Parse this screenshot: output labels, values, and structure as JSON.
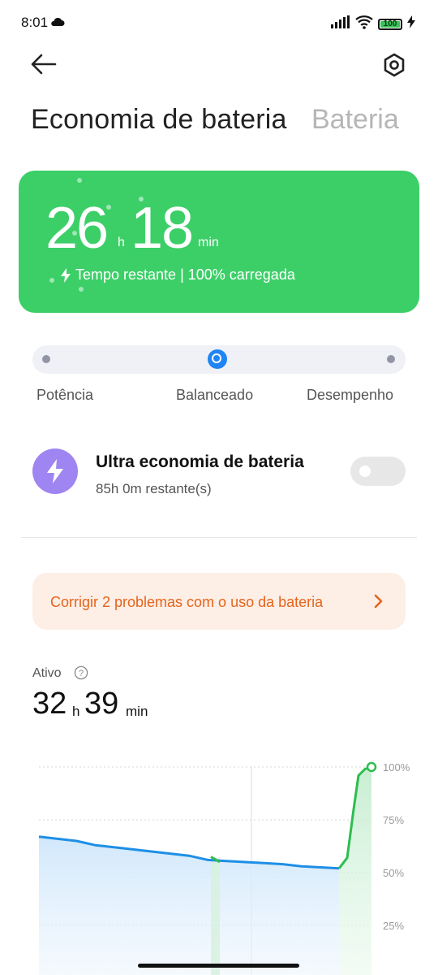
{
  "status": {
    "time": "8:01",
    "battery": "100"
  },
  "header": {
    "title": "Economia de bateria",
    "tab_other": "Bateria"
  },
  "card": {
    "hours": "26",
    "hours_unit": "h",
    "minutes": "18",
    "minutes_unit": "min",
    "subtitle": "Tempo restante | 100% carregada",
    "color": "#3ccf68"
  },
  "modes": {
    "items": [
      "Potência",
      "Balanceado",
      "Desempenho"
    ],
    "selected": "Balanceado",
    "accent": "#1f85f5"
  },
  "ultra": {
    "title": "Ultra economia de bateria",
    "subtitle": "85h 0m restante(s)",
    "enabled": false,
    "icon": "lightning-bolt-icon"
  },
  "fix_banner": {
    "text": "Corrigir 2 problemas com o uso da bateria",
    "color": "#e5641b"
  },
  "active": {
    "label": "Ativo",
    "hours": "32",
    "hours_unit": "h",
    "minutes": "39",
    "minutes_unit": "min"
  },
  "chart_data": {
    "type": "line",
    "y_ticks": [
      "100%",
      "75%",
      "50%",
      "25%"
    ],
    "ylim": [
      0,
      100
    ],
    "series": [
      {
        "values": [
          67,
          66,
          65,
          63,
          62,
          61,
          60,
          59,
          58,
          56,
          55.5,
          55,
          54.5,
          54,
          53,
          52.5,
          52
        ]
      },
      {
        "values": [
          52,
          57,
          80,
          96,
          99,
          100
        ]
      }
    ],
    "colors": {
      "discharge": "#1e8fe6",
      "charge": "#2ebd4f"
    }
  }
}
